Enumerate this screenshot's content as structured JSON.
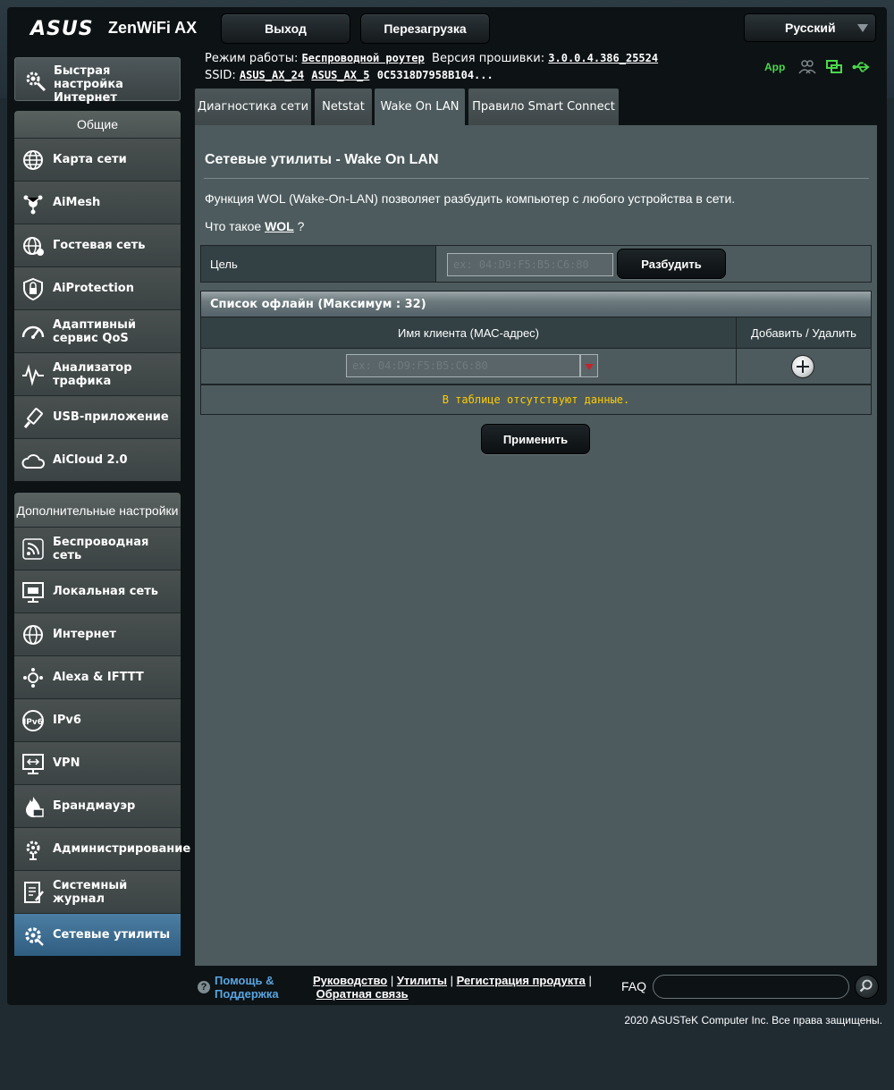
{
  "header": {
    "brand": "ASUS",
    "product": "ZenWiFi AX",
    "logout": "Выход",
    "reboot": "Перезагрузка",
    "language": "Русский",
    "mode_label": "Режим работы:",
    "mode_value": "Беспроводной роутер",
    "fw_label": "Версия прошивки:",
    "fw_value": "3.0.0.4.386_25524",
    "ssid_label": "SSID:",
    "ssid_1": "ASUS_AX_24",
    "ssid_2": "ASUS_AX_5",
    "mac_short": "0C5318D7958B104...",
    "app_label": "App"
  },
  "sidebar": {
    "quick_setup": "Быстрая настройка Интернет",
    "general_title": "Общие",
    "general_items": [
      {
        "label": "Карта сети",
        "icon": "globe-icon"
      },
      {
        "label": "AiMesh",
        "icon": "mesh-icon"
      },
      {
        "label": "Гостевая сеть",
        "icon": "guest-globe-icon"
      },
      {
        "label": "AiProtection",
        "icon": "shield-icon"
      },
      {
        "label": "Адаптивный сервис QoS",
        "icon": "gauge-icon"
      },
      {
        "label": "Анализатор трафика",
        "icon": "waveform-icon"
      },
      {
        "label": "USB-приложение",
        "icon": "usb-icon"
      },
      {
        "label": "AiCloud 2.0",
        "icon": "cloud-icon"
      }
    ],
    "advanced_title": "Дополнительные настройки",
    "advanced_items": [
      {
        "label": "Беспроводная сеть",
        "icon": "wifi-icon"
      },
      {
        "label": "Локальная сеть",
        "icon": "lan-icon"
      },
      {
        "label": "Интернет",
        "icon": "internet-globe-icon"
      },
      {
        "label": "Alexa & IFTTT",
        "icon": "alexa-icon"
      },
      {
        "label": "IPv6",
        "icon": "ipv6-icon"
      },
      {
        "label": "VPN",
        "icon": "vpn-icon"
      },
      {
        "label": "Брандмауэр",
        "icon": "firewall-icon"
      },
      {
        "label": "Администрирование",
        "icon": "admin-gear-icon"
      },
      {
        "label": "Системный журнал",
        "icon": "log-icon"
      },
      {
        "label": "Сетевые утилиты",
        "icon": "tools-gear-icon"
      }
    ]
  },
  "tabs": [
    "Диагностика сети",
    "Netstat",
    "Wake On LAN",
    "Правило Smart Connect"
  ],
  "content": {
    "title": "Сетевые утилиты - Wake On LAN",
    "description": "Функция WOL (Wake-On-LAN) позволяет разбудить компьютер с любого устройства в сети.",
    "what_is_prefix": "Что такое",
    "what_is_link": "WOL",
    "what_is_suffix": "?",
    "target_label": "Цель",
    "target_placeholder": "ex: 04:D9:F5:B5:C6:80",
    "wake_button": "Разбудить",
    "offline_list_title": "Список офлайн (Максимум : 32)",
    "col_client": "Имя клиента (МАС-адрес)",
    "col_action": "Добавить / Удалить",
    "client_placeholder": "ex: 04:D9:F5:B5:C6:80",
    "empty_message": "В таблице отсутствуют данные.",
    "apply_button": "Применить"
  },
  "footer": {
    "help": "Помощь & Поддержка",
    "link_manual": "Руководство",
    "link_utils": "Утилиты",
    "link_register": "Регистрация продукта",
    "link_feedback": "Обратная связь",
    "faq": "FAQ",
    "copyright": "2020 ASUSTeK Computer Inc. Все права защищены."
  },
  "colors": {
    "accent_active": "#2f5d80",
    "status_green": "#4ad84a",
    "empty_text": "#ffcc00",
    "help_link": "#5aa5e0"
  }
}
